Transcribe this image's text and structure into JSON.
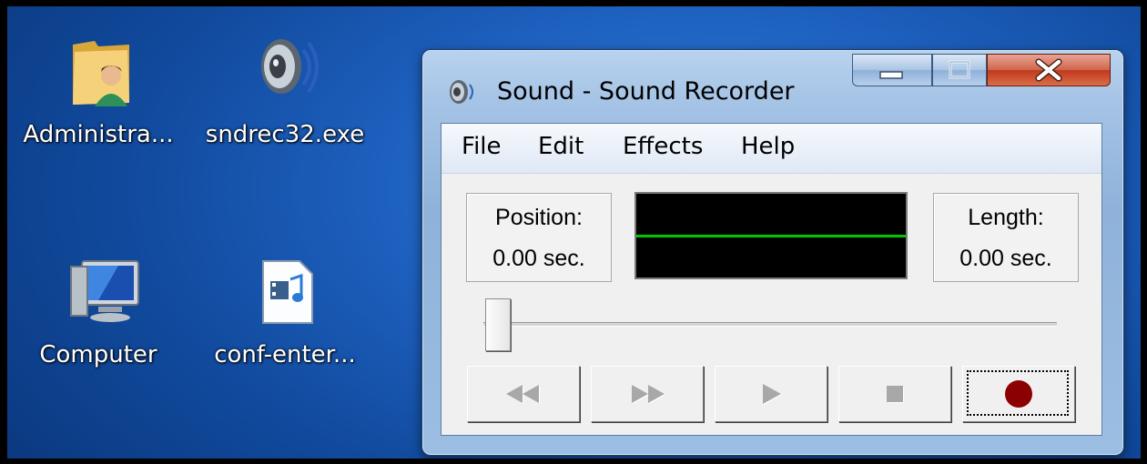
{
  "desktop": {
    "icons": [
      {
        "label": "Administra...",
        "icon": "user-folder-icon"
      },
      {
        "label": "sndrec32.exe",
        "icon": "speaker-icon"
      },
      {
        "label": "Computer",
        "icon": "computer-icon"
      },
      {
        "label": "conf-enter...",
        "icon": "media-file-icon"
      }
    ]
  },
  "window": {
    "title": "Sound - Sound Recorder",
    "menu": [
      "File",
      "Edit",
      "Effects",
      "Help"
    ],
    "position": {
      "label": "Position:",
      "value": "0.00 sec."
    },
    "length": {
      "label": "Length:",
      "value": "0.00 sec."
    },
    "seek_position": 0,
    "controls": [
      {
        "name": "seek-to-start",
        "icon": "rewind-icon",
        "enabled": false
      },
      {
        "name": "seek-to-end",
        "icon": "fast-forward-icon",
        "enabled": false
      },
      {
        "name": "play",
        "icon": "play-icon",
        "enabled": false
      },
      {
        "name": "stop",
        "icon": "stop-icon",
        "enabled": false
      },
      {
        "name": "record",
        "icon": "record-icon",
        "enabled": true,
        "focused": true
      }
    ]
  },
  "colors": {
    "record_dot": "#8b0000",
    "waveform_line": "#00c800",
    "disabled_glyph": "#a8a8a8",
    "close_button": "#c8432a"
  }
}
